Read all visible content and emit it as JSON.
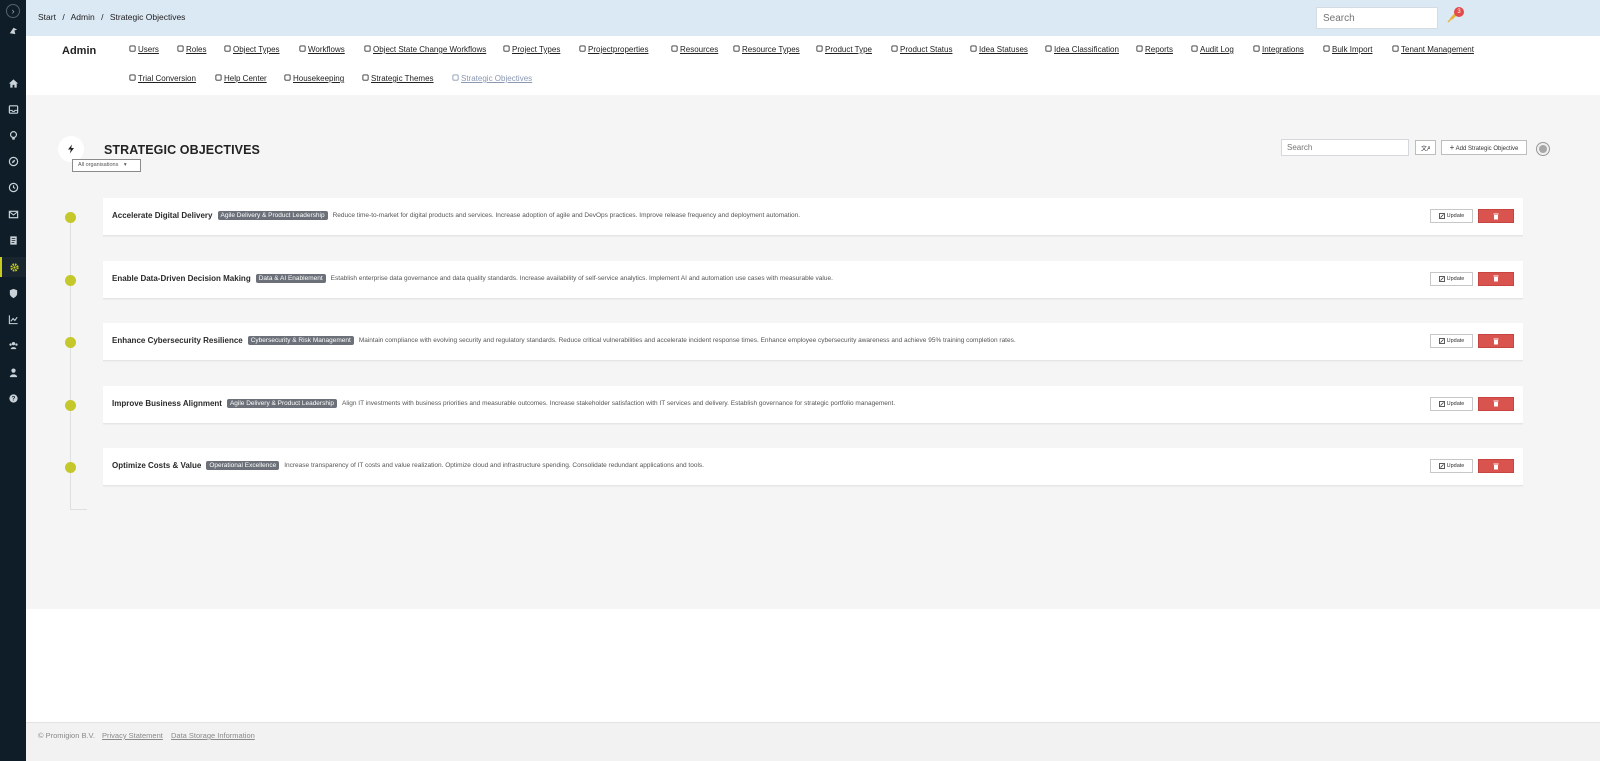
{
  "breadcrumb": [
    "Start",
    "/",
    "Admin",
    "/",
    "Strategic Objectives"
  ],
  "topbar": {
    "search_placeholder": "Search",
    "notification_count": "3"
  },
  "rail": {
    "items": [
      "home-icon",
      "inbox-icon",
      "lightbulb-icon",
      "compass-icon",
      "clock-icon",
      "mail-icon",
      "document-icon",
      "gear-icon",
      "shield-icon",
      "chart-icon",
      "users-icon",
      "user-icon",
      "help-icon"
    ],
    "active_index": 7,
    "accent_color": "#c8cc1f"
  },
  "admin_nav": {
    "title": "Admin",
    "row1": [
      {
        "label": "Users",
        "icon": "users-icon"
      },
      {
        "label": "Roles",
        "icon": "key-icon"
      },
      {
        "label": "Object Types",
        "icon": "folder-icon"
      },
      {
        "label": "Workflows",
        "icon": "shuffle-icon"
      },
      {
        "label": "Object State Change Workflows",
        "icon": "shuffle-icon"
      },
      {
        "label": "Project Types",
        "icon": "list-icon"
      },
      {
        "label": "Projectproperties",
        "icon": "list-icon"
      },
      {
        "label": "Resources",
        "icon": "book-icon"
      },
      {
        "label": "Resource Types",
        "icon": "card-icon"
      },
      {
        "label": "Product Type",
        "icon": "cubes-icon"
      },
      {
        "label": "Product Status",
        "icon": "pie-icon"
      },
      {
        "label": "Idea Statuses",
        "icon": "checklist-icon"
      },
      {
        "label": "Idea Classification",
        "icon": "tags-icon"
      },
      {
        "label": "Reports",
        "icon": "bar-chart-icon"
      },
      {
        "label": "Audit Log",
        "icon": "history-icon"
      },
      {
        "label": "Integrations",
        "icon": "heart-icon"
      },
      {
        "label": "Bulk Import",
        "icon": "user-plus-icon"
      },
      {
        "label": "Tenant Management",
        "icon": "building-icon"
      }
    ],
    "row2": [
      {
        "label": "Trial Conversion",
        "icon": "rocket-icon"
      },
      {
        "label": "Help Center",
        "icon": "info-icon"
      },
      {
        "label": "Housekeeping",
        "icon": "wrench-icon"
      },
      {
        "label": "Strategic Themes",
        "icon": "compass-icon"
      },
      {
        "label": "Strategic Objectives",
        "icon": "bullseye-icon",
        "current": true
      }
    ]
  },
  "main": {
    "title": "STRATEGIC OBJECTIVES",
    "org_filter": "All organisations",
    "search_placeholder": "Search",
    "add_button": "Add Strategic Objective",
    "update_label": "Update",
    "colors": {
      "dot": "#c4c82a",
      "badge": "#6b7079",
      "delete": "#d9534f"
    }
  },
  "objectives": [
    {
      "title": "Accelerate Digital Delivery",
      "theme": "Agile Delivery & Product Leadership",
      "description": "Reduce time-to-market for digital products and services. Increase adoption of agile and DevOps practices. Improve release frequency and deployment automation."
    },
    {
      "title": "Enable Data-Driven Decision Making",
      "theme": "Data & AI Enablement",
      "description": "Establish enterprise data governance and data quality standards. Increase availability of self-service analytics. Implement AI and automation use cases with measurable value."
    },
    {
      "title": "Enhance Cybersecurity Resilience",
      "theme": "Cybersecurity & Risk Management",
      "description": "Maintain compliance with evolving security and regulatory standards. Reduce critical vulnerabilities and accelerate incident response times. Enhance employee cybersecurity awareness and achieve 95% training completion rates."
    },
    {
      "title": "Improve Business Alignment",
      "theme": "Agile Delivery & Product Leadership",
      "description": "Align IT investments with business priorities and measurable outcomes. Increase stakeholder satisfaction with IT services and delivery. Establish governance for strategic portfolio management."
    },
    {
      "title": "Optimize Costs & Value",
      "theme": "Operational Excellence",
      "description": "Increase transparency of IT costs and value realization. Optimize cloud and infrastructure spending. Consolidate redundant applications and tools."
    }
  ],
  "footer": {
    "copyright": "© Promigion B.V.",
    "privacy": "Privacy Statement",
    "storage": "Data Storage Information"
  }
}
